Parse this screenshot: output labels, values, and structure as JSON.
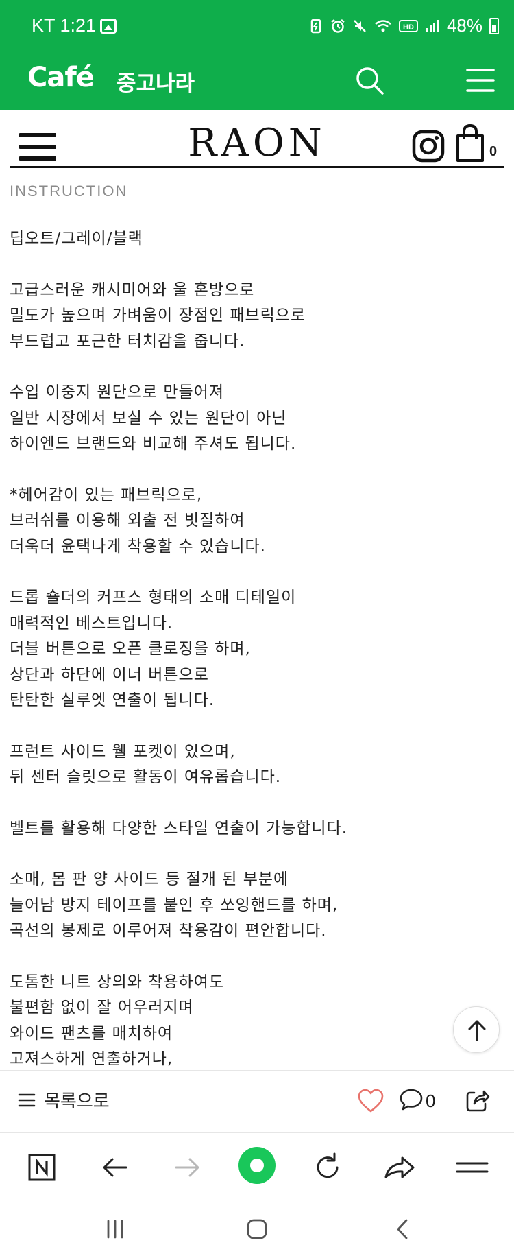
{
  "status_bar": {
    "carrier_time": "KT 1:21",
    "battery": "48%",
    "icons": [
      "image-icon",
      "battery-saver-icon",
      "alarm-icon",
      "mute-icon",
      "wifi-icon",
      "hd-icon",
      "signal-icon",
      "battery-icon"
    ]
  },
  "cafe_header": {
    "logo": "Café",
    "cafe_name": "중고나라",
    "accent_color": "#0fae4b"
  },
  "shop_header": {
    "brand": "RAON",
    "cart_count": "0"
  },
  "section_title": "INSTRUCTION",
  "paragraphs": [
    [
      "딥오트/그레이/블랙"
    ],
    [
      "고급스러운 캐시미어와 울 혼방으로",
      "밀도가 높으며 가벼움이 장점인 패브릭으로",
      "부드럽고 포근한 터치감을 줍니다."
    ],
    [
      "수입 이중지 원단으로 만들어져",
      "일반 시장에서 보실 수 있는 원단이 아닌",
      "하이엔드 브랜드와 비교해 주셔도 됩니다."
    ],
    [
      "*헤어감이 있는 패브릭으로,",
      "브러쉬를 이용해 외출 전 빗질하여",
      "더욱더 윤택나게 착용할 수 있습니다."
    ],
    [
      "드롭 숄더의 커프스 형태의 소매 디테일이",
      "매력적인 베스트입니다.",
      "더블 버튼으로 오픈 클로징을 하며,",
      "상단과 하단에 이너 버튼으로",
      "탄탄한 실루엣 연출이 됩니다."
    ],
    [
      "프런트 사이드 웰 포켓이 있으며,",
      "뒤 센터 슬릿으로 활동이 여유롭습니다."
    ],
    [
      "벨트를 활용해 다양한 스타일 연출이 가능합니다."
    ],
    [
      "소매, 몸 판 양 사이드 등 절개 된 부분에",
      "늘어남 방지 테이프를 붙인 후 쏘잉핸드를 하며,",
      "곡선의 봉제로 이루어져 착용감이 편안합니다."
    ],
    [
      "도톰한 니트 상의와 착용하여도",
      "불편함 없이 잘 어우러지며",
      "와이드 팬츠를 매치하여",
      "고져스하게 연출하거나,"
    ]
  ],
  "article_bar": {
    "list_label": "목록으로",
    "comment_count": "0"
  }
}
